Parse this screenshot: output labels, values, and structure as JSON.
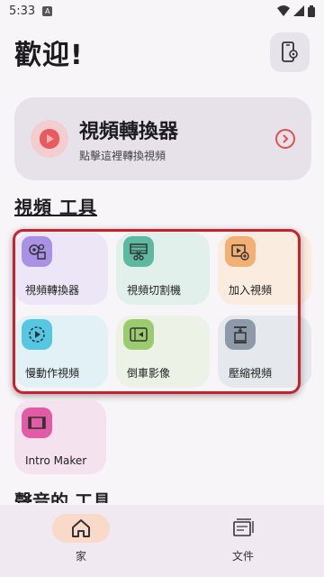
{
  "status": {
    "time": "5:33",
    "badge": "A"
  },
  "header": {
    "title": "歡迎!"
  },
  "hero": {
    "title": "視頻轉換器",
    "subtitle": "點擊這裡轉換視頻"
  },
  "section": {
    "title": "視頻 工具",
    "next_title": "聲音的 工具"
  },
  "tools": [
    {
      "label": "視頻轉換器",
      "icon": "gears-video-icon",
      "bg": "#ede6f6",
      "icon_bg": "#a992e6"
    },
    {
      "label": "視頻切割機",
      "icon": "film-cut-icon",
      "bg": "#e2f0ec",
      "icon_bg": "#5fb8a0"
    },
    {
      "label": "加入視頻",
      "icon": "add-video-icon",
      "bg": "#fbece0",
      "icon_bg": "#f2b074"
    },
    {
      "label": "慢動作視頻",
      "icon": "slow-motion-icon",
      "bg": "#e1f1f6",
      "icon_bg": "#56c7e3"
    },
    {
      "label": "倒車影像",
      "icon": "reverse-video-icon",
      "bg": "#edf2e6",
      "icon_bg": "#9bcb6e"
    },
    {
      "label": "壓縮視頻",
      "icon": "compress-icon",
      "bg": "#e5e8ec",
      "icon_bg": "#8e9aa8"
    }
  ],
  "intro": {
    "label": "Intro Maker",
    "icon": "intro-film-icon"
  },
  "nav": {
    "home": "家",
    "files": "文件"
  },
  "colors": {
    "accent": "#e2504a",
    "selection": "#c8232c",
    "nav_active": "#f9d9ca"
  }
}
